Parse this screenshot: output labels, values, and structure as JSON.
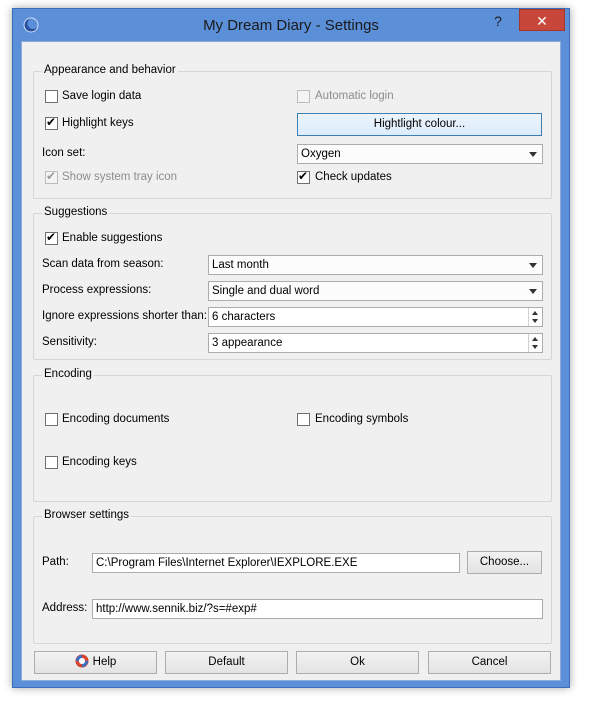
{
  "window": {
    "title": "My Dream Diary - Settings",
    "help_glyph": "?",
    "close_glyph": "✕"
  },
  "appearance": {
    "title": "Appearance and behavior",
    "save_login_data": {
      "label": "Save login data",
      "checked": false
    },
    "automatic_login": {
      "label": "Automatic login",
      "checked": false,
      "disabled": true
    },
    "highlight_keys": {
      "label": "Highlight keys",
      "checked": true
    },
    "highlight_colour_button": "Hightlight colour...",
    "icon_set_label": "Icon set:",
    "icon_set_value": "Oxygen",
    "show_tray_icon": {
      "label": "Show system tray icon",
      "checked": true,
      "disabled": true
    },
    "check_updates": {
      "label": "Check updates",
      "checked": true
    }
  },
  "suggestions": {
    "title": "Suggestions",
    "enable": {
      "label": "Enable suggestions",
      "checked": true
    },
    "scan_label": "Scan data from season:",
    "scan_value": "Last month",
    "process_label": "Process expressions:",
    "process_value": "Single and dual word",
    "ignore_label": "Ignore expressions shorter than:",
    "ignore_value": "6 characters",
    "sensitivity_label": "Sensitivity:",
    "sensitivity_value": "3 appearance"
  },
  "encoding": {
    "title": "Encoding",
    "documents": {
      "label": "Encoding documents",
      "checked": false
    },
    "symbols": {
      "label": "Encoding symbols",
      "checked": false
    },
    "keys": {
      "label": "Encoding keys",
      "checked": false
    }
  },
  "browser": {
    "title": "Browser settings",
    "path_label": "Path:",
    "path_value": "C:\\Program Files\\Internet Explorer\\IEXPLORE.EXE",
    "choose_button": "Choose...",
    "address_label": "Address:",
    "address_value": "http://www.sennik.biz/?s=#exp#"
  },
  "footer": {
    "help": "Help",
    "default": "Default",
    "ok": "Ok",
    "cancel": "Cancel"
  }
}
